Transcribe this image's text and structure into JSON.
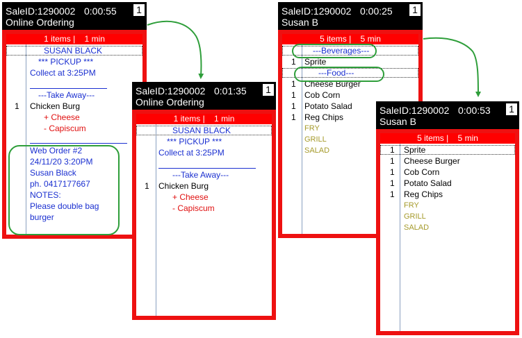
{
  "tickets": [
    {
      "sale_id": "SaleID:1290002",
      "timer": "0:00:55",
      "number": "1",
      "customer": "Online Ordering",
      "summary": "1 items |    1 min",
      "lines": {
        "name": "SUSAN BLACK",
        "pickup": "*** PICKUP ***",
        "collect": "Collect at  3:25PM",
        "takeaway": "---Take Away---",
        "qty": "1",
        "item": "Chicken Burg",
        "mod1": "+ Cheese",
        "mod2": "- Capiscum",
        "web_order": "Web Order #2",
        "datetime": "24/11/20  3:20PM",
        "cust_name": "Susan Black",
        "phone": "ph. 0417177667",
        "notes_label": "NOTES:",
        "note1": "Please double bag",
        "note2": "burger"
      }
    },
    {
      "sale_id": "SaleID:1290002",
      "timer": "0:01:35",
      "number": "1",
      "customer": "Online Ordering",
      "summary": "1 items |    1 min",
      "lines": {
        "name": "SUSAN BLACK",
        "pickup": "*** PICKUP ***",
        "collect": "Collect at  3:25PM",
        "takeaway": "---Take Away---",
        "qty": "1",
        "item": "Chicken Burg",
        "mod1": "+ Cheese",
        "mod2": "- Capiscum"
      }
    },
    {
      "sale_id": "SaleID:1290002",
      "timer": "0:00:25",
      "number": "1",
      "customer": "Susan B",
      "summary": "5 items |    5 min",
      "lines": {
        "beverages": "---Beverages---",
        "food": "---Food---",
        "items": [
          {
            "qty": "1",
            "name": "Sprite"
          },
          {
            "qty": "1",
            "name": "Cheese Burger"
          },
          {
            "qty": "1",
            "name": "Cob Corn"
          },
          {
            "qty": "1",
            "name": "Potato Salad"
          },
          {
            "qty": "1",
            "name": "Reg Chips"
          }
        ],
        "tags": [
          "FRY",
          "GRILL",
          "SALAD"
        ]
      }
    },
    {
      "sale_id": "SaleID:1290002",
      "timer": "0:00:53",
      "number": "1",
      "customer": "Susan B",
      "summary": "5 items |    5 min",
      "lines": {
        "items": [
          {
            "qty": "1",
            "name": "Sprite"
          },
          {
            "qty": "1",
            "name": "Cheese Burger"
          },
          {
            "qty": "1",
            "name": "Cob Corn"
          },
          {
            "qty": "1",
            "name": "Potato Salad"
          },
          {
            "qty": "1",
            "name": "Reg Chips"
          }
        ],
        "tags": [
          "FRY",
          "GRILL",
          "SALAD"
        ]
      }
    }
  ],
  "colors": {
    "header_bg": "#000000",
    "frame_red": "#ee1111",
    "summary_red": "#ff0000",
    "text_blue": "#1a2fd0",
    "modifier_red": "#e01010",
    "tag_olive": "#a59a2a",
    "annotation_green": "#2e9e3a"
  }
}
